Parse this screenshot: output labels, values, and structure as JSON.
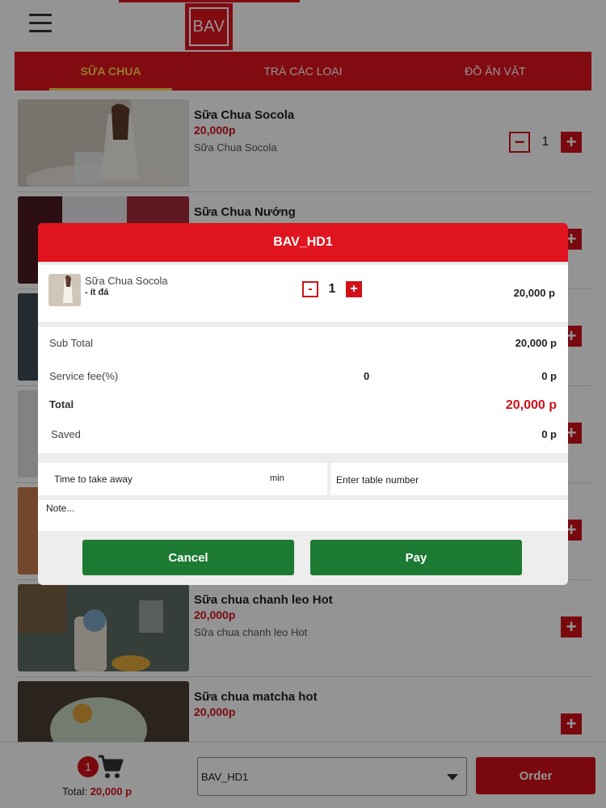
{
  "header": {
    "logo_text": "BAV"
  },
  "tabs": [
    {
      "label": "SỮA CHUA",
      "active": true
    },
    {
      "label": "TRÀ CÁC LOẠI",
      "active": false
    },
    {
      "label": "ĐỒ ĂN VẶT",
      "active": false
    }
  ],
  "products": [
    {
      "name": "Sữa Chua Socola",
      "price": "20,000p",
      "desc": "Sữa Chua Socola",
      "qty": "1"
    },
    {
      "name": "Sữa Chua Nướng",
      "price": "",
      "desc": "",
      "qty": ""
    },
    {
      "name": "",
      "price": "",
      "desc": "",
      "qty": ""
    },
    {
      "name": "",
      "price": "",
      "desc": "",
      "qty": ""
    },
    {
      "name": "",
      "price": "",
      "desc": "",
      "qty": ""
    },
    {
      "name": "Sữa chua chanh leo Hot",
      "price": "20,000p",
      "desc": "Sữa chua chanh leo Hot",
      "qty": ""
    },
    {
      "name": "Sữa chua matcha hot",
      "price": "20,000p",
      "desc": "",
      "qty": ""
    }
  ],
  "modal": {
    "title": "BAV_HD1",
    "line_item": {
      "name": "Sữa Chua Socola",
      "note": "- ít đá",
      "minus": "-",
      "qty": "1",
      "plus": "+",
      "price": "20,000 p"
    },
    "summary": {
      "subtotal_label": "Sub Total",
      "subtotal_value": "20,000 p",
      "service_label": "Service fee(%)",
      "service_percent": "0",
      "service_value": "0 p",
      "total_label": "Total",
      "total_value": "20,000 p",
      "saved_label": "Saved",
      "saved_value": "0 p"
    },
    "time_placeholder": "Time to take away",
    "time_unit": "min",
    "table_placeholder": "Enter table number",
    "note_placeholder": "Note...",
    "cancel_label": "Cancel",
    "pay_label": "Pay"
  },
  "bottom": {
    "cart_count": "1",
    "total_label": "Total:",
    "total_value": "20,000 p",
    "table_select_value": "BAV_HD1",
    "order_label": "Order"
  },
  "colors": {
    "brand_red": "#e0141e",
    "accent_yellow": "#ffd34a",
    "action_green": "#1c7a33"
  }
}
